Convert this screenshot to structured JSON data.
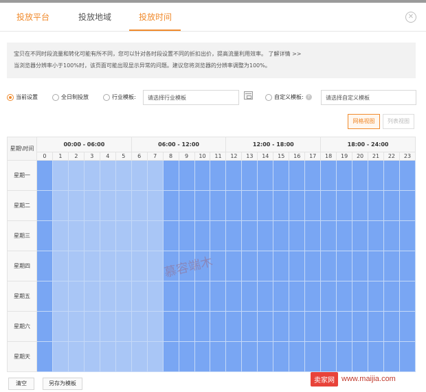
{
  "tabs": [
    {
      "label": "投放平台",
      "active": false
    },
    {
      "label": "投放地域",
      "active": false
    },
    {
      "label": "投放时间",
      "active": true
    }
  ],
  "close_icon": "circle-close-icon",
  "notice": {
    "line1": "宝贝在不同时段流量和转化可能有所不同，您可以针对各时段设置不同的折扣出价，提高流量利用效率。",
    "more_link": "了解详情 >>",
    "line2": "当浏览器分辨率小于100%时，该页面可能出现显示异常的问题。建议您将浏览器的分辨率调整为100%。"
  },
  "options": {
    "current": "当前设置",
    "all_day": "全日制投放",
    "industry": "行业模板:",
    "industry_placeholder": "请选择行业模板",
    "custom": "自定义模板:",
    "custom_placeholder": "请选择自定义模板",
    "selected": "current"
  },
  "views": {
    "grid": "网格视图",
    "list": "列表视图",
    "active": "grid"
  },
  "table": {
    "corner": "星期\\时间",
    "ranges": [
      "00:00 - 06:00",
      "06:00 - 12:00",
      "12:00 - 18:00",
      "18:00 - 24:00"
    ],
    "hours": [
      "0",
      "1",
      "2",
      "3",
      "4",
      "5",
      "6",
      "7",
      "8",
      "9",
      "10",
      "11",
      "12",
      "13",
      "14",
      "15",
      "16",
      "17",
      "18",
      "19",
      "20",
      "21",
      "22",
      "23"
    ],
    "days": [
      "星期一",
      "星期二",
      "星期三",
      "星期四",
      "星期五",
      "星期六",
      "星期天"
    ],
    "hour_state": [
      "on",
      "light",
      "light",
      "light",
      "light",
      "light",
      "light",
      "light",
      "on",
      "on",
      "on",
      "on",
      "on",
      "on",
      "on",
      "on",
      "on",
      "on",
      "on",
      "on",
      "on",
      "on",
      "on",
      "on"
    ]
  },
  "watermark": "慕容端木",
  "buttons": {
    "clear": "清空",
    "save_template": "另存为模板"
  },
  "site_badge": {
    "logo": "卖家网",
    "url": "www.maijia.com"
  },
  "colors": {
    "accent": "#f08a2c",
    "slot_on": "#79a6f3",
    "slot_light": "#a9c6f6"
  }
}
